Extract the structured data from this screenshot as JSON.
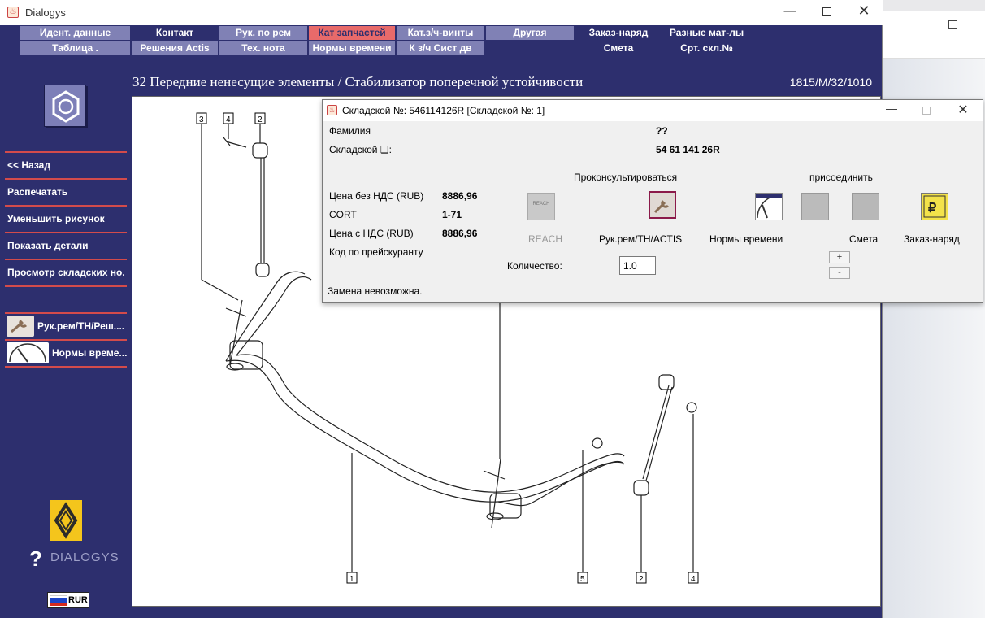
{
  "app": {
    "title": "Dialogys"
  },
  "menu": {
    "row1": [
      "Идент. данные",
      "Контакт",
      "Рук. по рем",
      "Кат запчастей",
      "Кат.з/ч-винты",
      "Другая",
      "Заказ-наряд",
      "Разные мат-лы"
    ],
    "row2": [
      "Таблица .",
      "Решения Actis",
      "Тех. нота",
      "Нормы времени",
      "К з/ч Сист дв",
      "",
      "Смета",
      "Срт. скл.№"
    ],
    "active": "Кат запчастей"
  },
  "sidebar": {
    "items": [
      "<< Назад",
      "Распечатать",
      "Уменьшить рисунок",
      "Показать детали",
      "Просмотр складских но..."
    ],
    "shortcuts": [
      "Рук.рем/ТН/Реш....",
      "Нормы време..."
    ],
    "brand": "DIALOGYS",
    "currency": "RUR"
  },
  "header": {
    "title": "32 Передние ненесущие элементы / Стабилизатор поперечной устойчивости",
    "code": "1815/M/32/1010"
  },
  "diagram": {
    "callouts": [
      "3",
      "4",
      "2",
      "1",
      "5",
      "2",
      "4"
    ]
  },
  "dialog": {
    "title": "Складской №: 546114126R [Складской №: 1]",
    "family_label": "Фамилия",
    "family_value": "??",
    "stock_label": "Складской ❑:",
    "stock_value": "54 61 141 26R",
    "consult_label": "Проконсультироваться",
    "attach_label": "присоединить",
    "price_no_vat_label": "Цена без НДС (RUB)",
    "price_no_vat_value": "8886,96",
    "cort_label": "CORT",
    "cort_value": "1-71",
    "price_vat_label": "Цена с НДС (RUB)",
    "price_vat_value": "8886,96",
    "price_code_label": "Код по прейскуранту",
    "buttons": {
      "reach": "REACH",
      "reach_icon_text": "REACH",
      "rukrem": "Рук.рем/ТН/ACTIS",
      "norms": "Нормы времени",
      "smeta": "Смета",
      "zakaz": "Заказ-наряд"
    },
    "quantity_label": "Количество:",
    "quantity_value": "1.0",
    "plus": "+",
    "minus": "-",
    "status": "Замена невозможна."
  }
}
